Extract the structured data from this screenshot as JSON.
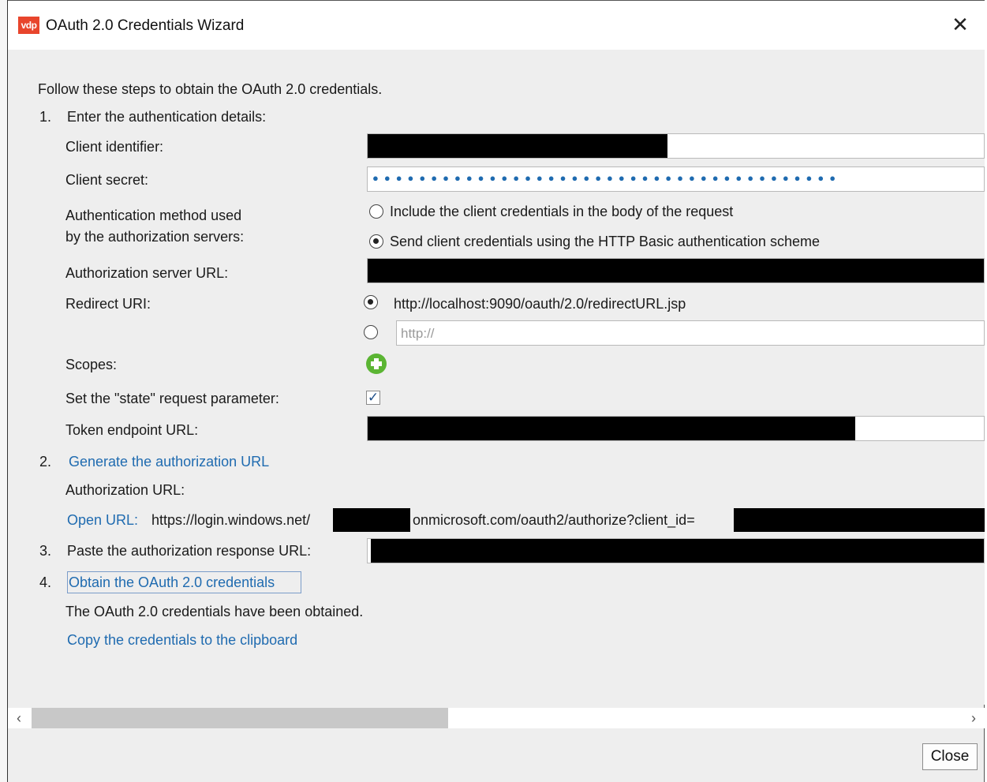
{
  "window": {
    "logo_text": "vdp",
    "title": "OAuth 2.0 Credentials Wizard",
    "close_glyph": "✕"
  },
  "intro": "Follow these steps to obtain the OAuth 2.0 credentials.",
  "step1": {
    "num": "1.",
    "title": "Enter the authentication details:",
    "client_identifier_label": "Client identifier:",
    "client_secret_label": "Client secret:",
    "client_secret_masked": "●●●●●●●●●●●●●●●●●●●●●●●●●●●●●●●●●●●●●●●●",
    "auth_method_label_1": "Authentication method used",
    "auth_method_label_2": "by the authorization servers:",
    "auth_method_options": [
      {
        "label": "Include the client credentials in the body of the request",
        "checked": false
      },
      {
        "label": "Send client credentials using the HTTP Basic authentication scheme",
        "checked": true
      }
    ],
    "auth_server_url_label": "Authorization server URL:",
    "redirect_uri_label": "Redirect URI:",
    "redirect_default": "http://localhost:9090/oauth/2.0/redirectURL.jsp",
    "redirect_custom_placeholder": "http://",
    "scopes_label": "Scopes:",
    "state_param_label": "Set the \"state\" request parameter:",
    "state_param_checked": true,
    "token_endpoint_label": "Token endpoint URL:"
  },
  "step2": {
    "num": "2.",
    "link": "Generate the authorization URL",
    "auth_url_label": "Authorization URL:",
    "open_url_link": "Open URL:",
    "url_part1": "https://login.windows.net/",
    "url_part2": "onmicrosoft.com/oauth2/authorize?client_id="
  },
  "step3": {
    "num": "3.",
    "label": "Paste the authorization response URL:"
  },
  "step4": {
    "num": "4.",
    "link": "Obtain the OAuth 2.0 credentials",
    "status": "The OAuth 2.0 credentials have been obtained.",
    "copy_link": "Copy the credentials to the clipboard"
  },
  "scrollbar": {
    "left_arrow": "‹",
    "right_arrow": "›"
  },
  "footer": {
    "close_label": "Close"
  },
  "colors": {
    "link": "#1f6bb0",
    "logo": "#e8452c",
    "add_icon": "#5bb533",
    "mask_dots": "#1f6bb0"
  }
}
